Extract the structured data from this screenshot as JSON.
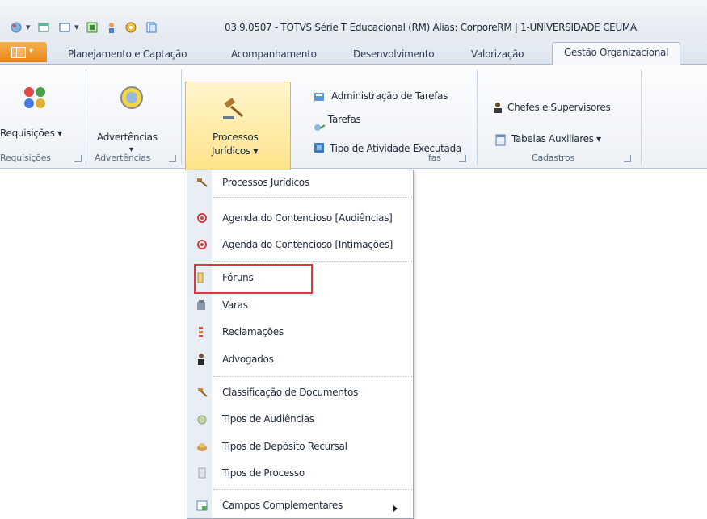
{
  "window": {
    "title": "03.9.0507 - TOTVS Série T Educacional (RM) Alias: CorporeRM | 1-UNIVERSIDADE CEUMA"
  },
  "tabs": [
    "Planejamento e Captação",
    "Acompanhamento",
    "Desenvolvimento",
    "Valorização",
    "Gestão Organizacional"
  ],
  "active_tab": "Gestão Organizacional",
  "ribbon": {
    "requisicoes": {
      "button": "Requisições",
      "group": "Requisições"
    },
    "advertencias": {
      "button": "Advertências",
      "group": "Advertências"
    },
    "processos": {
      "line1": "Processos",
      "line2": "Jurídicos"
    },
    "tarefas_group": {
      "items": [
        "Administração de Tarefas",
        "Tarefas",
        "Tipo de Atividade Executada"
      ],
      "group": "fas"
    },
    "cadastros": {
      "items": [
        "Chefes e Supervisores",
        "Tabelas Auxiliares"
      ],
      "group": "Cadastros"
    }
  },
  "menu": {
    "items": [
      "Processos Jurídicos",
      "Agenda do Contencioso [Audiências]",
      "Agenda do Contencioso [Intimações]",
      "Fóruns",
      "Varas",
      "Reclamações",
      "Advogados",
      "Classificação de Documentos",
      "Tipos de Audiências",
      "Tipos de Depósito Recursal",
      "Tipos de Processo",
      "Campos Complementares"
    ],
    "highlighted": "Fóruns"
  },
  "colors": {
    "accent_orange": "#e7851a",
    "highlight_red": "#d73b3b",
    "button_hover": "#ffe38a"
  }
}
